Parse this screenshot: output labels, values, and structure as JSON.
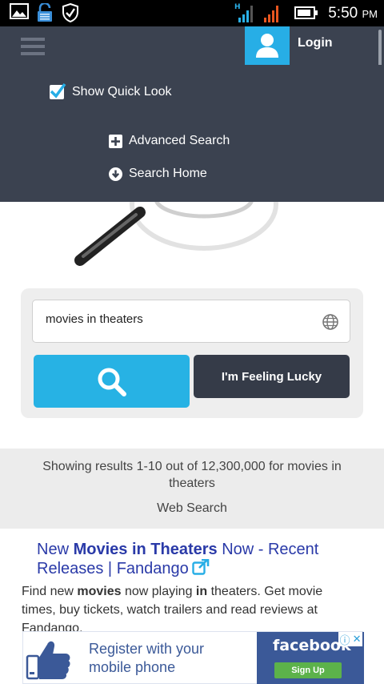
{
  "status_bar": {
    "time": "5:50",
    "ampm": "PM",
    "icons": [
      "image-icon",
      "lock-icon",
      "shield-icon",
      "signal-h-icon",
      "signal-icon",
      "battery-icon"
    ]
  },
  "header": {
    "menu_icon": "hamburger-icon",
    "avatar_icon": "user-icon",
    "login_label": "Login"
  },
  "dropdown": {
    "quick_look_label": "Show Quick Look",
    "quick_look_checked": true,
    "advanced_search_label": "Advanced Search",
    "search_home_label": "Search Home"
  },
  "search": {
    "query": "movies in theaters",
    "globe_icon": "globe-icon",
    "search_icon": "search-icon",
    "lucky_label": "I'm Feeling Lucky"
  },
  "results": {
    "count_text": "Showing results 1-10 out of 12,300,000 for movies in theaters",
    "tab_label": "Web Search",
    "items": [
      {
        "title_a": "New ",
        "title_b": "Movies in Theaters",
        "title_c": " Now - Recent Releases | Fandango",
        "snippet_a": "Find new ",
        "snippet_b": "movies",
        "snippet_c": " now playing ",
        "snippet_d": "in",
        "snippet_e": " theaters. Get movie times, buy tickets, watch trailers and read reviews at Fandango."
      }
    ]
  },
  "ad": {
    "text": "Register with your mobile phone",
    "brand": "facebook",
    "cta": "Sign Up",
    "accent": "#3b5998"
  },
  "colors": {
    "header_bg": "#3b4250",
    "accent_blue": "#27b2e4",
    "button_dark": "#353b48",
    "link_blue": "#2a3aa8"
  }
}
